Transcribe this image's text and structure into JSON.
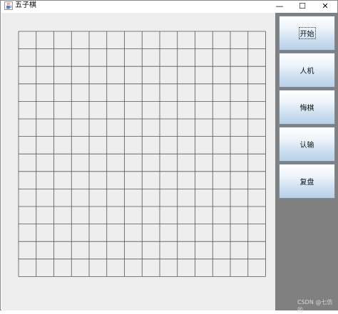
{
  "window": {
    "title": "五子棋",
    "icon": "java-cup-icon",
    "controls": {
      "minimize": "—",
      "maximize": "☐",
      "close": "✕"
    }
  },
  "board": {
    "columns": 14,
    "rows": 14,
    "line_color": "#555555",
    "background": "#eeeeee"
  },
  "side_panel": {
    "background": "#808080",
    "buttons": [
      {
        "label": "开始",
        "focused": true
      },
      {
        "label": "人机",
        "focused": false
      },
      {
        "label": "悔棋",
        "focused": false
      },
      {
        "label": "认输",
        "focused": false
      },
      {
        "label": "复盘",
        "focused": false
      }
    ]
  },
  "watermark": "CSDN @七仿的"
}
